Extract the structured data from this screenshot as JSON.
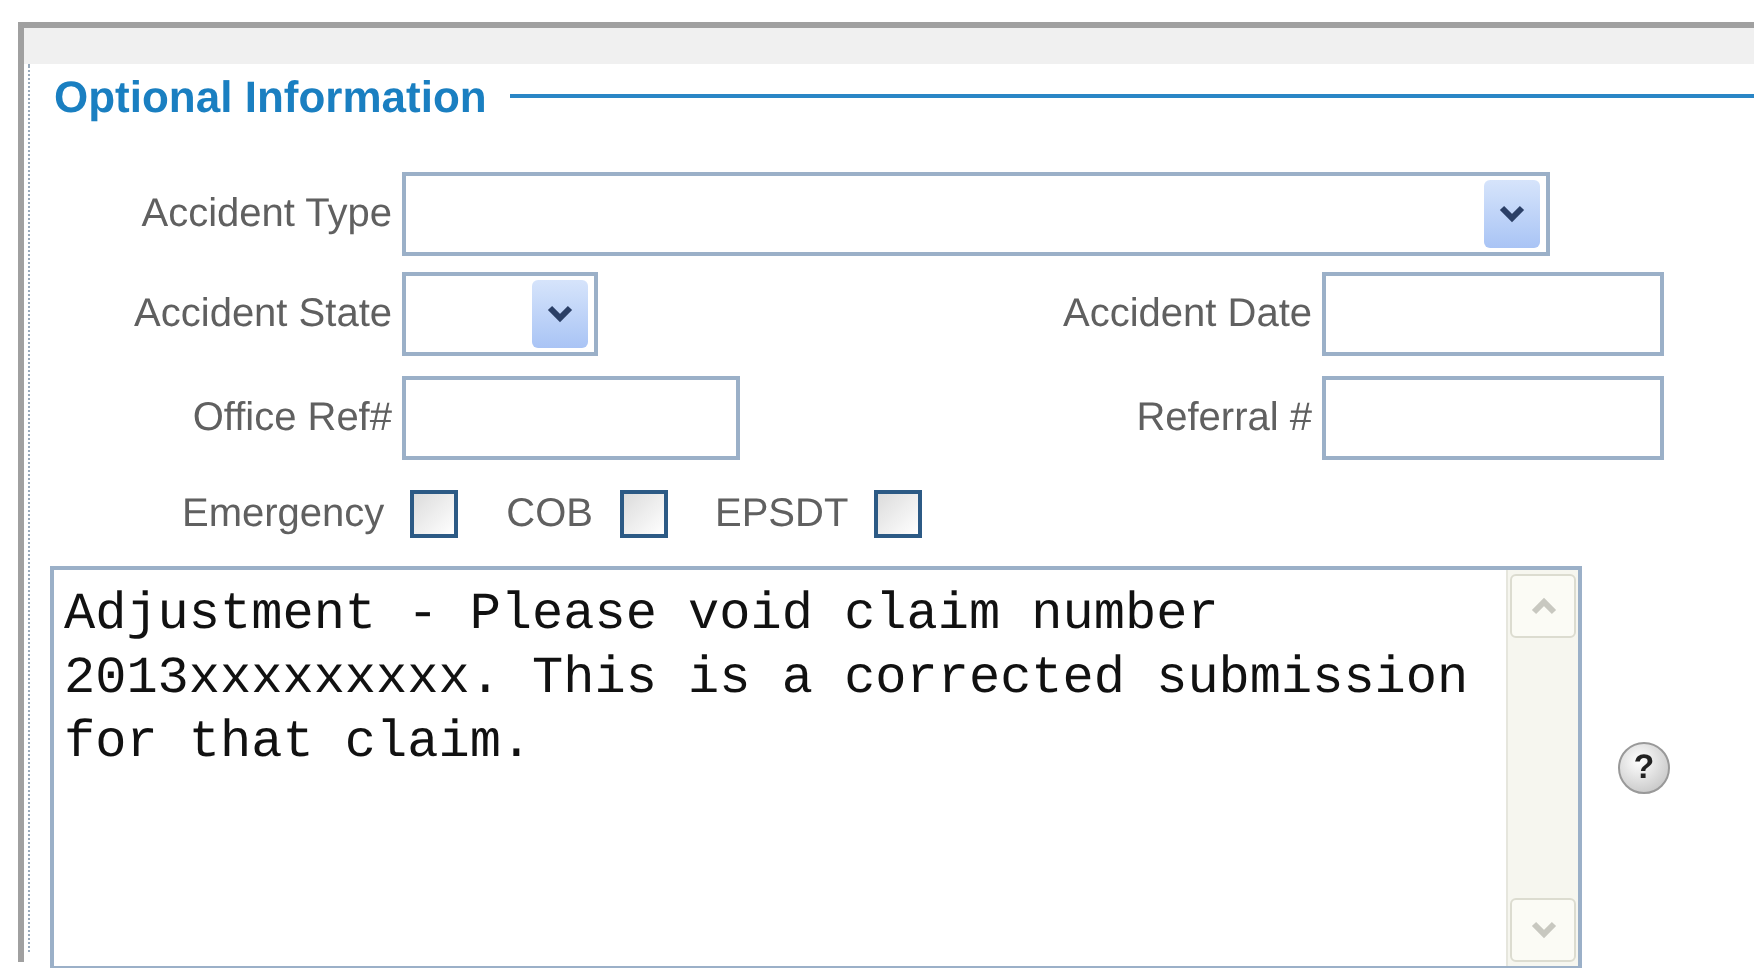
{
  "section": {
    "title": "Optional Information"
  },
  "rows": [
    {
      "fields": [
        {
          "label": "Accident Type",
          "kind": "select"
        }
      ]
    },
    {
      "fields": [
        {
          "label": "Accident State",
          "kind": "select"
        },
        {
          "label": "Accident Date",
          "kind": "text"
        }
      ]
    },
    {
      "fields": [
        {
          "label": "Office Ref#",
          "kind": "text"
        },
        {
          "label": "Referral #",
          "kind": "text"
        }
      ]
    }
  ],
  "checkboxes": [
    {
      "label": "Emergency",
      "checked": false
    },
    {
      "label": "COB",
      "checked": false
    },
    {
      "label": "EPSDT",
      "checked": false
    }
  ],
  "notes": {
    "value": "Adjustment - Please void claim number 2013xxxxxxxxx. This is a corrected submission for that claim.",
    "help": "?"
  }
}
